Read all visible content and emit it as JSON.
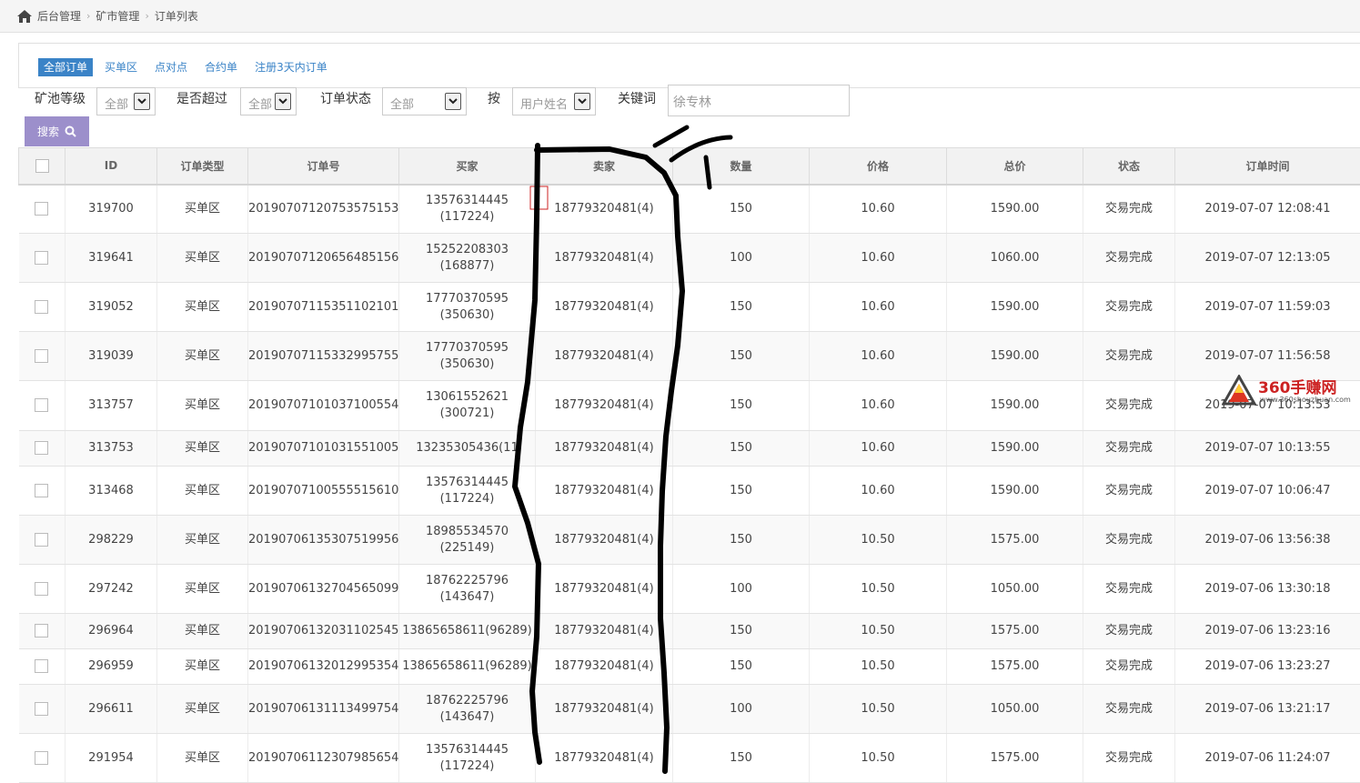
{
  "breadcrumb": [
    "后台管理",
    "矿市管理",
    "订单列表"
  ],
  "tabs": [
    {
      "label": "全部订单",
      "active": true
    },
    {
      "label": "买单区"
    },
    {
      "label": "点对点"
    },
    {
      "label": "合约单"
    },
    {
      "label": "注册3天内订单"
    }
  ],
  "filters": {
    "level_label": "矿池等级",
    "level_value": "全部",
    "exceed_label": "是否超过",
    "exceed_value": "全部",
    "status_label": "订单状态",
    "status_value": "全部",
    "by_label": "按",
    "by_value": "用户姓名",
    "keyword_label": "关键词",
    "keyword_value": "徐专林",
    "search_label": "搜索"
  },
  "table": {
    "headers": [
      "ID",
      "订单类型",
      "订单号",
      "买家",
      "卖家",
      "数量",
      "价格",
      "总价",
      "状态",
      "订单时间"
    ],
    "rows": [
      {
        "id": "319700",
        "type": "买单区",
        "order": "20190707120753575153",
        "buyer1": "13576314445",
        "buyer2": "(117224)",
        "seller": "18779320481(4)",
        "qty": "150",
        "price": "10.60",
        "total": "1590.00",
        "status": "交易完成",
        "time": "2019-07-07 12:08:41"
      },
      {
        "id": "319641",
        "type": "买单区",
        "order": "20190707120656485156",
        "buyer1": "15252208303",
        "buyer2": "(168877)",
        "seller": "18779320481(4)",
        "qty": "100",
        "price": "10.60",
        "total": "1060.00",
        "status": "交易完成",
        "time": "2019-07-07 12:13:05"
      },
      {
        "id": "319052",
        "type": "买单区",
        "order": "20190707115351102101",
        "buyer1": "17770370595",
        "buyer2": "(350630)",
        "seller": "18779320481(4)",
        "qty": "150",
        "price": "10.60",
        "total": "1590.00",
        "status": "交易完成",
        "time": "2019-07-07 11:59:03"
      },
      {
        "id": "319039",
        "type": "买单区",
        "order": "20190707115332995755",
        "buyer1": "17770370595",
        "buyer2": "(350630)",
        "seller": "18779320481(4)",
        "qty": "150",
        "price": "10.60",
        "total": "1590.00",
        "status": "交易完成",
        "time": "2019-07-07 11:56:58"
      },
      {
        "id": "313757",
        "type": "买单区",
        "order": "20190707101037100554",
        "buyer1": "13061552621",
        "buyer2": "(300721)",
        "seller": "18779320481(4)",
        "qty": "150",
        "price": "10.60",
        "total": "1590.00",
        "status": "交易完成",
        "time": "2019-07-07 10:13:53"
      },
      {
        "id": "313753",
        "type": "买单区",
        "order": "20190707101031551005",
        "buyer1": "13235305436(11",
        "buyer2": "",
        "seller": "18779320481(4)",
        "qty": "150",
        "price": "10.60",
        "total": "1590.00",
        "status": "交易完成",
        "time": "2019-07-07 10:13:55"
      },
      {
        "id": "313468",
        "type": "买单区",
        "order": "20190707100555515610",
        "buyer1": "13576314445",
        "buyer2": "(117224)",
        "seller": "18779320481(4)",
        "qty": "150",
        "price": "10.60",
        "total": "1590.00",
        "status": "交易完成",
        "time": "2019-07-07 10:06:47"
      },
      {
        "id": "298229",
        "type": "买单区",
        "order": "20190706135307519956",
        "buyer1": "18985534570",
        "buyer2": "(225149)",
        "seller": "18779320481(4)",
        "qty": "150",
        "price": "10.50",
        "total": "1575.00",
        "status": "交易完成",
        "time": "2019-07-06 13:56:38"
      },
      {
        "id": "297242",
        "type": "买单区",
        "order": "20190706132704565099",
        "buyer1": "18762225796",
        "buyer2": "(143647)",
        "seller": "18779320481(4)",
        "qty": "100",
        "price": "10.50",
        "total": "1050.00",
        "status": "交易完成",
        "time": "2019-07-06 13:30:18"
      },
      {
        "id": "296964",
        "type": "买单区",
        "order": "20190706132031102545",
        "buyer1": "13865658611(96289)",
        "buyer2": "",
        "seller": "18779320481(4)",
        "qty": "150",
        "price": "10.50",
        "total": "1575.00",
        "status": "交易完成",
        "time": "2019-07-06 13:23:16"
      },
      {
        "id": "296959",
        "type": "买单区",
        "order": "20190706132012995354",
        "buyer1": "13865658611(96289)",
        "buyer2": "",
        "seller": "18779320481(4)",
        "qty": "150",
        "price": "10.50",
        "total": "1575.00",
        "status": "交易完成",
        "time": "2019-07-06 13:23:27"
      },
      {
        "id": "296611",
        "type": "买单区",
        "order": "20190706131113499754",
        "buyer1": "18762225796",
        "buyer2": "(143647)",
        "seller": "18779320481(4)",
        "qty": "100",
        "price": "10.50",
        "total": "1050.00",
        "status": "交易完成",
        "time": "2019-07-06 13:21:17"
      },
      {
        "id": "291954",
        "type": "买单区",
        "order": "20190706112307985654",
        "buyer1": "13576314445",
        "buyer2": "(117224)",
        "seller": "18779320481(4)",
        "qty": "150",
        "price": "10.50",
        "total": "1575.00",
        "status": "交易完成",
        "time": "2019-07-06 11:24:07"
      }
    ]
  },
  "watermark": {
    "name": "360手赚网",
    "url": "www.360shouzhuan.com"
  },
  "colors": {
    "accent": "#3a83c7",
    "search_button": "#9c8fcb",
    "annotation_ink": "#000000"
  }
}
